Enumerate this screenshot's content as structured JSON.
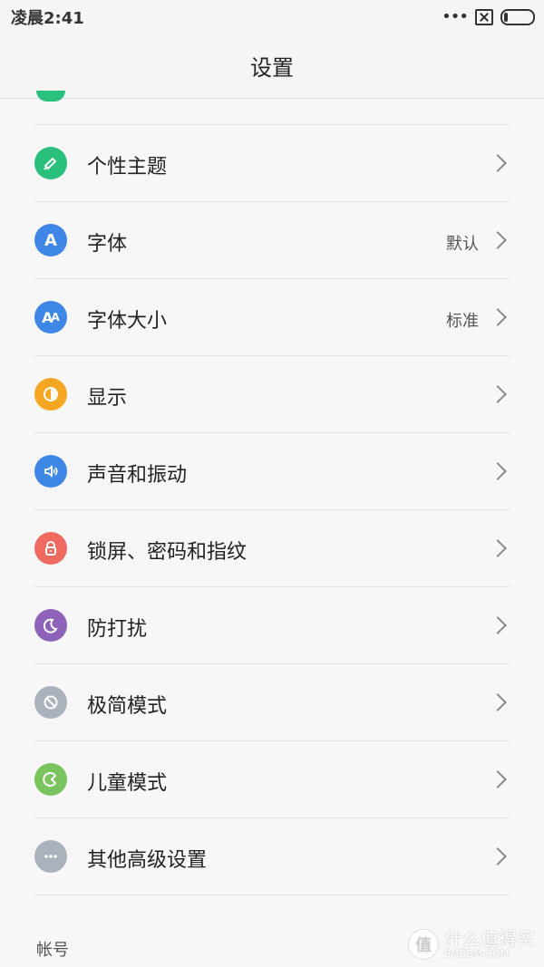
{
  "status": {
    "time": "凌晨2:41",
    "dots": "•••"
  },
  "header": {
    "title": "设置"
  },
  "colors": {
    "theme": "#28c07a",
    "font": "#3f87e6",
    "font_size": "#3f87e6",
    "display": "#f5a623",
    "sound": "#3f87e6",
    "lock": "#ef6b61",
    "dnd": "#8e62b8",
    "simple": "#aab3bc",
    "kids": "#7ac35e",
    "more": "#aab3bc"
  },
  "items": [
    {
      "label": "个性主题",
      "value": "",
      "icon": "paint-brush-icon"
    },
    {
      "label": "字体",
      "value": "默认",
      "icon": "letter-a-icon"
    },
    {
      "label": "字体大小",
      "value": "标准",
      "icon": "font-size-icon"
    },
    {
      "label": "显示",
      "value": "",
      "icon": "brightness-icon"
    },
    {
      "label": "声音和振动",
      "value": "",
      "icon": "speaker-icon"
    },
    {
      "label": "锁屏、密码和指纹",
      "value": "",
      "icon": "lock-icon"
    },
    {
      "label": "防打扰",
      "value": "",
      "icon": "moon-icon"
    },
    {
      "label": "极简模式",
      "value": "",
      "icon": "simple-mode-icon"
    },
    {
      "label": "儿童模式",
      "value": "",
      "icon": "kids-mode-icon"
    },
    {
      "label": "其他高级设置",
      "value": "",
      "icon": "more-icon"
    }
  ],
  "section": {
    "account": "帐号"
  },
  "watermark": {
    "main": "什么值得买",
    "sub": "SMZDM.COM",
    "badge": "值"
  }
}
